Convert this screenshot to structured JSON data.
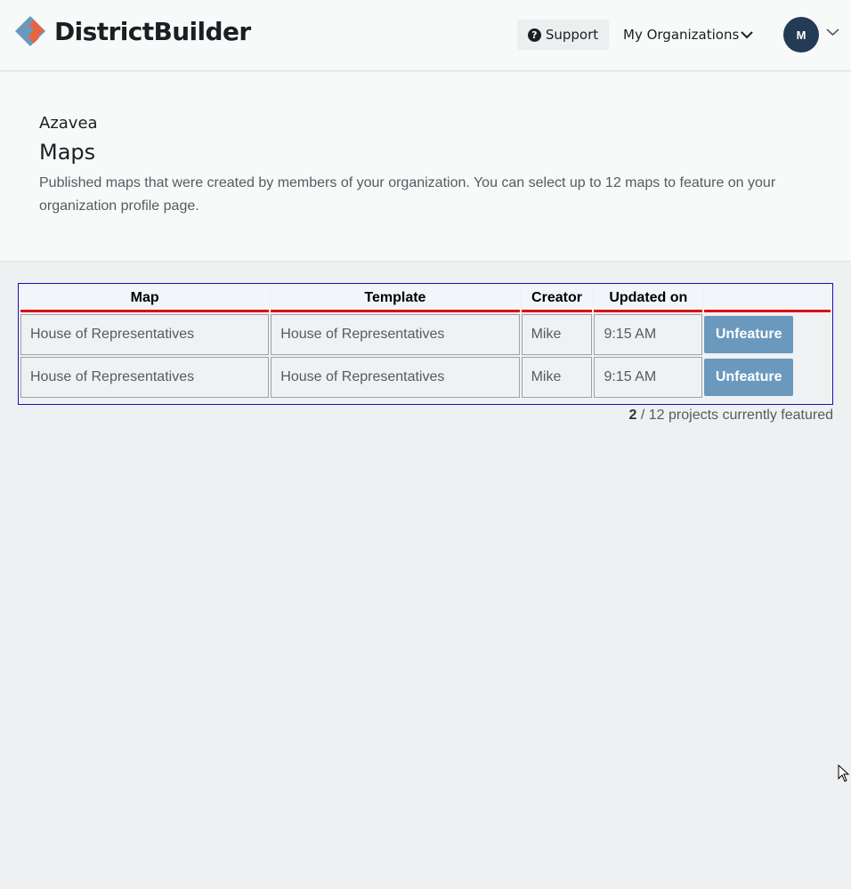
{
  "header": {
    "brand": "DistrictBuilder",
    "support_label": "Support",
    "organizations_label": "My Organizations",
    "avatar_initial": "M"
  },
  "intro": {
    "org_name": "Azavea",
    "title": "Maps",
    "description": "Published maps that were created by members of your organization. You can select up to 12 maps to feature on your organization profile page."
  },
  "table": {
    "columns": [
      "Map",
      "Template",
      "Creator",
      "Updated on",
      ""
    ],
    "rows": [
      {
        "map": "House of Representatives",
        "template": "House of Representatives",
        "creator": "Mike",
        "updated": "9:15 AM",
        "action": "Unfeature"
      },
      {
        "map": "House of Representatives",
        "template": "House of Representatives",
        "creator": "Mike",
        "updated": "9:15 AM",
        "action": "Unfeature"
      }
    ]
  },
  "featured": {
    "count": "2",
    "text": "/ 12 projects currently featured"
  },
  "colors": {
    "accent_button": "#6b98bd",
    "avatar": "#233b55",
    "logo_blue": "#6b98bd",
    "logo_orange": "#e9633f",
    "table_border": "#1a10b8",
    "header_underline": "#e01010"
  },
  "icons": {
    "logo": "districtbuilder-logo-icon",
    "support": "question-circle-icon",
    "org_menu": "chevron-down-icon",
    "avatar_menu": "chevron-down-icon",
    "cursor": "mouse-pointer-icon"
  }
}
